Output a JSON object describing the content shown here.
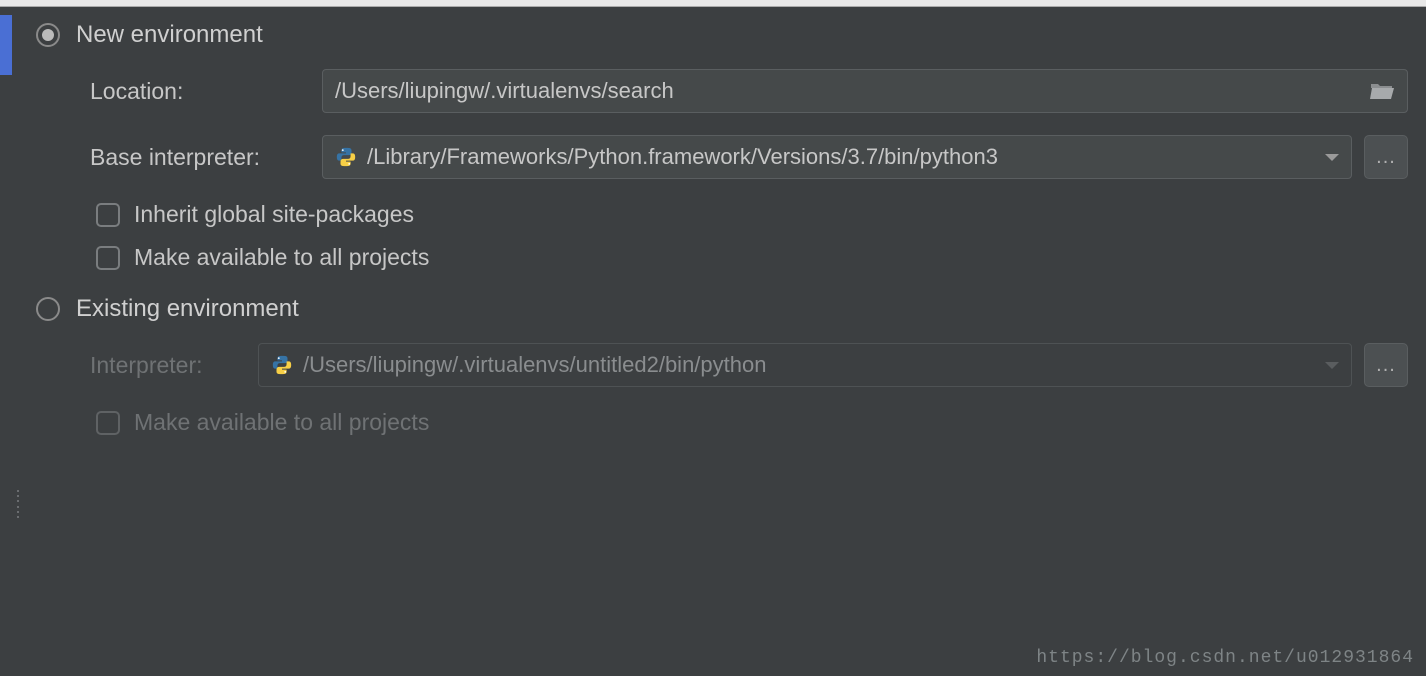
{
  "newEnv": {
    "radioLabel": "New environment",
    "locationLabel": "Location:",
    "locationValue": "/Users/liupingw/.virtualenvs/search",
    "baseLabel": "Base interpreter:",
    "baseValue": "/Library/Frameworks/Python.framework/Versions/3.7/bin/python3",
    "inheritLabel": "Inherit global site-packages",
    "makeAvailLabel": "Make available to all projects"
  },
  "existingEnv": {
    "radioLabel": "Existing environment",
    "interpLabel": "Interpreter:",
    "interpValue": "/Users/liupingw/.virtualenvs/untitled2/bin/python",
    "makeAvailLabel": "Make available to all projects"
  },
  "browseDots": "...",
  "watermark": "https://blog.csdn.net/u012931864"
}
